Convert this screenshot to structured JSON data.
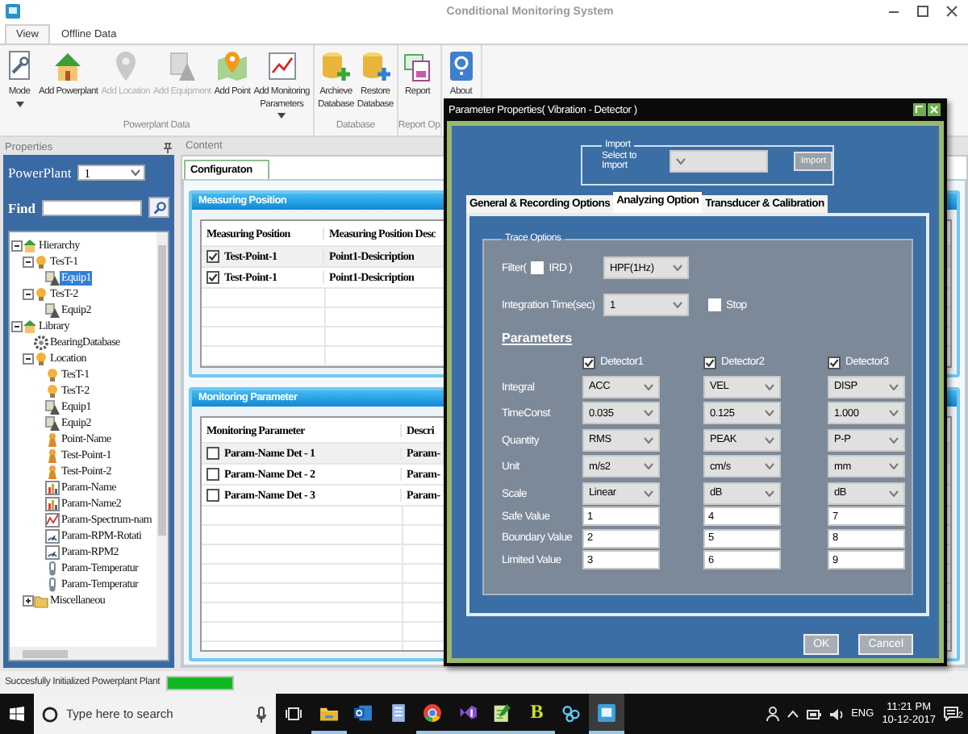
{
  "window": {
    "title": "Conditional Monitoring System"
  },
  "ribbon_tabs": [
    {
      "label": "View",
      "selected": true
    },
    {
      "label": "Offline Data",
      "selected": false
    }
  ],
  "ribbon_groups": [
    {
      "label": "Powerplant Data",
      "buttons": [
        {
          "label": "Mode",
          "kind": "mode",
          "disabled": false,
          "dropdown": true
        },
        {
          "label": "Add Powerplant",
          "kind": "powerplant",
          "disabled": false,
          "dropdown": false
        },
        {
          "label": "Add Location",
          "kind": "location",
          "disabled": true,
          "dropdown": false
        },
        {
          "label": "Add Equipment",
          "kind": "equipment",
          "disabled": true,
          "dropdown": false
        },
        {
          "label": "Add Point",
          "kind": "point",
          "disabled": false,
          "dropdown": false
        },
        {
          "label": "Add Monitoring\nParameters",
          "kind": "parameters",
          "disabled": false,
          "dropdown": true
        }
      ]
    },
    {
      "label": "Database",
      "buttons": [
        {
          "label": "Archieve\nDatabase",
          "kind": "archive",
          "disabled": false,
          "dropdown": false
        },
        {
          "label": "Restore\nDatabase",
          "kind": "restore",
          "disabled": false,
          "dropdown": false
        }
      ]
    },
    {
      "label": "Report Op",
      "buttons": [
        {
          "label": "Report",
          "kind": "report",
          "disabled": false,
          "dropdown": false
        }
      ]
    },
    {
      "buttons": [
        {
          "label": "About",
          "kind": "about",
          "disabled": false,
          "dropdown": false
        }
      ]
    }
  ],
  "properties": {
    "title": "Properties",
    "powerplant_label": "PowerPlant",
    "powerplant_value": "1",
    "find_label": "Find",
    "tree": [
      {
        "label": "Hierarchy",
        "kind": "home",
        "expanded": true,
        "selected": false,
        "children": [
          {
            "label": "TesT-1",
            "kind": "location",
            "expanded": true,
            "selected": false,
            "children": [
              {
                "label": "Equip1",
                "kind": "equipment",
                "selected": true
              }
            ]
          },
          {
            "label": "TesT-2",
            "kind": "location",
            "expanded": true,
            "selected": false,
            "children": [
              {
                "label": "Equip2",
                "kind": "equipment",
                "selected": false
              }
            ]
          }
        ]
      },
      {
        "label": "Library",
        "kind": "home",
        "expanded": true,
        "selected": false,
        "children": [
          {
            "label": "BearingDatabase",
            "kind": "gear",
            "selected": false
          },
          {
            "label": "Location",
            "kind": "location",
            "expanded": true,
            "selected": false,
            "children": [
              {
                "label": "TesT-1",
                "kind": "location",
                "selected": false
              },
              {
                "label": "TesT-2",
                "kind": "location",
                "selected": false
              },
              {
                "label": "Equip1",
                "kind": "equipment",
                "selected": false
              },
              {
                "label": "Equip2",
                "kind": "equipment",
                "selected": false
              },
              {
                "label": "Point-Name",
                "kind": "point",
                "selected": false
              },
              {
                "label": "Test-Point-1",
                "kind": "point",
                "selected": false
              },
              {
                "label": "Test-Point-2",
                "kind": "point",
                "selected": false
              },
              {
                "label": "Param-Name",
                "kind": "chart",
                "selected": false
              },
              {
                "label": "Param-Name2",
                "kind": "chart",
                "selected": false
              },
              {
                "label": "Param-Spectrum-nam",
                "kind": "spectrum",
                "selected": false
              },
              {
                "label": "Param-RPM-Rotati",
                "kind": "gauge",
                "selected": false
              },
              {
                "label": "Param-RPM2",
                "kind": "gauge",
                "selected": false
              },
              {
                "label": "Param-Temperatur",
                "kind": "thermometer",
                "selected": false
              },
              {
                "label": "Param-Temperatur",
                "kind": "thermometer",
                "selected": false
              }
            ]
          },
          {
            "label": "Miscellaneou",
            "kind": "folder",
            "expanded": false,
            "selected": false
          }
        ]
      }
    ]
  },
  "content": {
    "title": "Content",
    "tabs": [
      {
        "label": "Configuraton",
        "selected": true
      }
    ],
    "sections": [
      {
        "title": "Measuring Position",
        "columns": [
          "Measuring Position",
          "Measuring Position Desc"
        ],
        "rows": [
          {
            "checked": true,
            "cells": [
              "Test-Point-1",
              "Point1-Desicription"
            ]
          },
          {
            "checked": true,
            "cells": [
              "Test-Point-1",
              "Point1-Desicription"
            ]
          }
        ]
      },
      {
        "title": "Monitoring Parameter",
        "columns": [
          "Monitoring Parameter",
          "Descri"
        ],
        "rows": [
          {
            "checked": false,
            "cells": [
              "Param-Name Det - 1",
              "Param-"
            ]
          },
          {
            "checked": false,
            "cells": [
              "Param-Name Det - 2",
              "Param-"
            ]
          },
          {
            "checked": false,
            "cells": [
              "Param-Name Det - 3",
              "Param-"
            ]
          }
        ]
      }
    ]
  },
  "dialog": {
    "title": "Parameter Properties( Vibration - Detector )",
    "import": {
      "legend": "Import",
      "label": "Select to Import",
      "button": "Import"
    },
    "tabs": [
      {
        "label": "General & Recording Options",
        "selected": false
      },
      {
        "label": "Analyzing Option",
        "selected": true
      },
      {
        "label": "Transducer & Calibration",
        "selected": false
      }
    ],
    "trace_options": {
      "legend": "Trace Options",
      "filter_label": "Filter(",
      "ird": {
        "label": "IRD )",
        "checked": false
      },
      "filter_value": "HPF(1Hz)",
      "integration_label": "Integration Time(sec)",
      "integration_value": "1",
      "stop": {
        "label": "Stop",
        "checked": false
      },
      "parameters_heading": "Parameters",
      "detectors": [
        {
          "label": "Detector1",
          "checked": true
        },
        {
          "label": "Detector2",
          "checked": true
        },
        {
          "label": "Detector3",
          "checked": true
        }
      ],
      "rows": [
        {
          "label": "Integral",
          "kind": "select",
          "values": [
            "ACC",
            "VEL",
            "DISP"
          ]
        },
        {
          "label": "TimeConst",
          "kind": "select",
          "values": [
            "0.035",
            "0.125",
            "1.000"
          ]
        },
        {
          "label": "Quantity",
          "kind": "select",
          "values": [
            "RMS",
            "PEAK",
            "P-P"
          ]
        },
        {
          "label": "Unit",
          "kind": "select",
          "values": [
            "m/s2",
            "cm/s",
            "mm"
          ]
        },
        {
          "label": "Scale",
          "kind": "select",
          "values": [
            "Linear",
            "dB",
            "dB"
          ]
        },
        {
          "label": "Safe Value",
          "kind": "input",
          "values": [
            "1",
            "4",
            "7"
          ]
        },
        {
          "label": "Boundary Value",
          "kind": "input",
          "values": [
            "2",
            "5",
            "8"
          ]
        },
        {
          "label": "Limited Value",
          "kind": "input",
          "values": [
            "3",
            "6",
            "9"
          ]
        }
      ]
    },
    "buttons": [
      "OK",
      "Cancel"
    ]
  },
  "status_bar": {
    "message": "Succesfully Initialized Powerplant Plant",
    "level": 1
  },
  "taskbar": {
    "search_placeholder": "Type here to search",
    "apps": [
      {
        "kind": "folder",
        "running": true,
        "active": false
      },
      {
        "kind": "mail",
        "running": false,
        "active": false
      },
      {
        "kind": "notebook",
        "running": false,
        "active": false
      },
      {
        "kind": "browser",
        "running": true,
        "active": false
      },
      {
        "kind": "studio",
        "running": true,
        "active": false
      },
      {
        "kind": "notepad",
        "running": true,
        "active": false
      },
      {
        "kind": "letter",
        "label": "B",
        "running": true,
        "active": false
      },
      {
        "kind": "people",
        "running": false,
        "active": false
      },
      {
        "kind": "window",
        "running": true,
        "active": true
      }
    ],
    "language": "ENG",
    "time": "11:21 PM",
    "date": "10-12-2017",
    "notifications": "2"
  }
}
